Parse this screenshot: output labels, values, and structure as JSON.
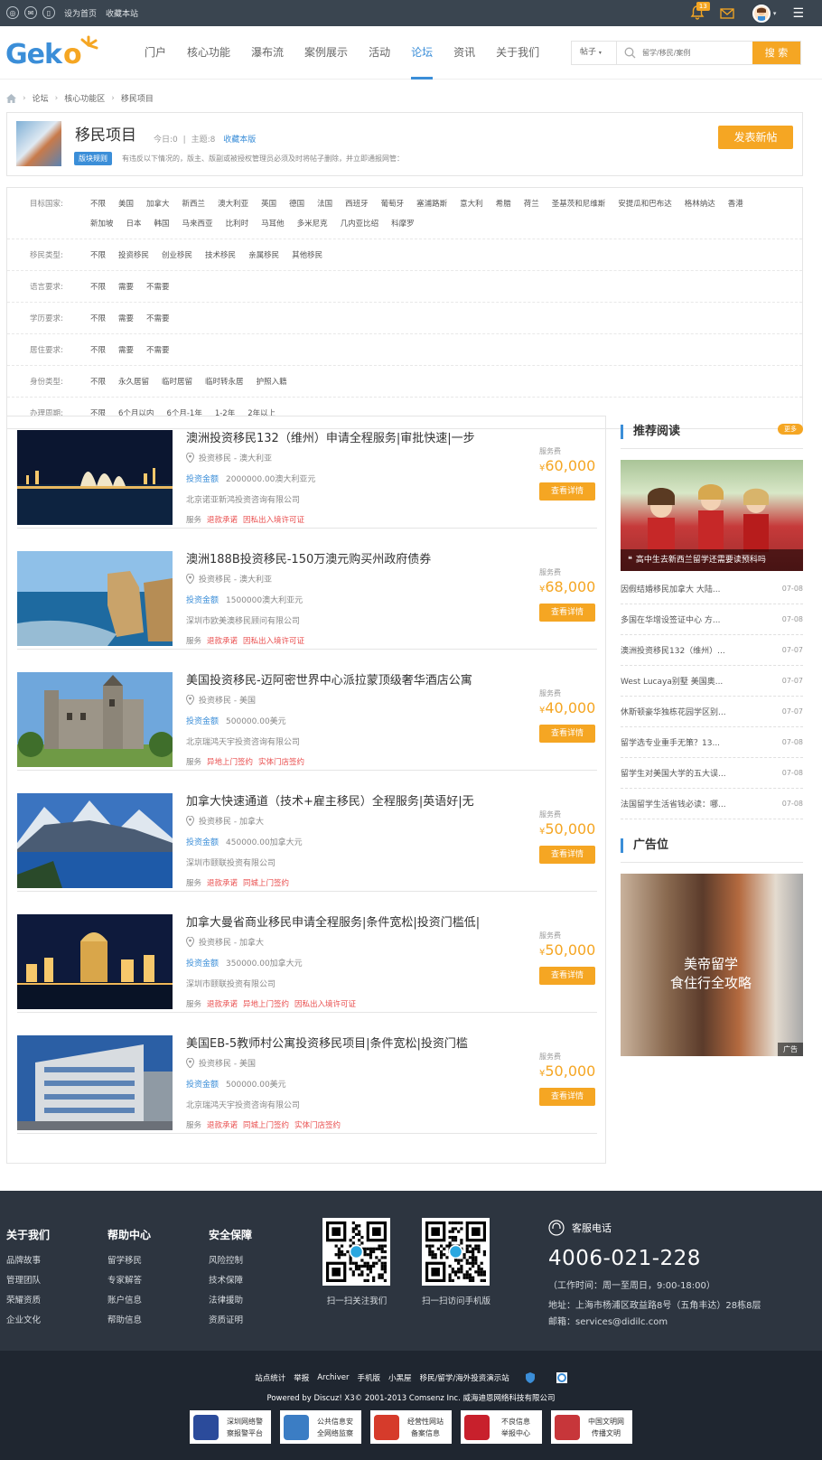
{
  "topbar": {
    "set_home": "设为首页",
    "bookmark": "收藏本站",
    "notice_count": "13"
  },
  "header": {
    "logo": "Geko",
    "nav": [
      "门户",
      "核心功能",
      "瀑布流",
      "案例展示",
      "活动",
      "论坛",
      "资讯",
      "关于我们"
    ],
    "active_nav": "论坛",
    "search_type": "帖子",
    "search_placeholder": "留学/移民/案例",
    "search_button": "搜 索"
  },
  "breadcrumb": [
    "论坛",
    "核心功能区",
    "移民项目"
  ],
  "forum": {
    "name": "移民项目",
    "today": "今日:0",
    "sep": "|",
    "topics": "主题:8",
    "favorite": "收藏本版",
    "rule_label": "版块规则",
    "notice": "有违反以下情况的，版主、版副或被授权管理员必须及时将帖子删除，并立即通报网管：",
    "post_button": "发表新帖"
  },
  "filters": [
    {
      "label": "目标国家:",
      "options": [
        "不限",
        "美国",
        "加拿大",
        "新西兰",
        "澳大利亚",
        "英国",
        "德国",
        "法国",
        "西班牙",
        "葡萄牙",
        "塞浦路斯",
        "意大利",
        "希腊",
        "荷兰",
        "圣基茨和尼维斯",
        "安提瓜和巴布达",
        "格林纳达",
        "香港",
        "新加坡",
        "日本",
        "韩国",
        "马来西亚",
        "比利时",
        "马耳他",
        "多米尼克",
        "几内亚比绍",
        "科摩罗"
      ]
    },
    {
      "label": "移民类型:",
      "options": [
        "不限",
        "投资移民",
        "创业移民",
        "技术移民",
        "亲属移民",
        "其他移民"
      ]
    },
    {
      "label": "语言要求:",
      "options": [
        "不限",
        "需要",
        "不需要"
      ]
    },
    {
      "label": "学历要求:",
      "options": [
        "不限",
        "需要",
        "不需要"
      ]
    },
    {
      "label": "居住要求:",
      "options": [
        "不限",
        "需要",
        "不需要"
      ]
    },
    {
      "label": "身份类型:",
      "options": [
        "不限",
        "永久居留",
        "临时居留",
        "临时转永居",
        "护照入籍"
      ]
    },
    {
      "label": "办理周期:",
      "options": [
        "不限",
        "6个月以内",
        "6个月-1年",
        "1-2年",
        "2年以上"
      ]
    }
  ],
  "listing_labels": {
    "amount": "投资金额",
    "service": "服务",
    "fee": "服务费",
    "currency": "¥",
    "detail": "查看详情"
  },
  "items": [
    {
      "title": "澳洲投资移民132（维州）申请全程服务|审批快速|一步",
      "location": "投资移民 - 澳大利亚",
      "amount": "2000000.00澳大利亚元",
      "company": "北京诺亚新鸿投资咨询有限公司",
      "tags": [
        "退款承诺",
        "因私出入境许可证"
      ],
      "price": "60,000"
    },
    {
      "title": "澳洲188B投资移民-150万澳元购买州政府债券",
      "location": "投资移民 - 澳大利亚",
      "amount": "1500000澳大利亚元",
      "company": "深圳市欧美澳移民顾问有限公司",
      "tags": [
        "退款承诺",
        "因私出入境许可证"
      ],
      "price": "68,000"
    },
    {
      "title": "美国投资移民-迈阿密世界中心派拉蒙顶级奢华酒店公寓",
      "location": "投资移民 - 美国",
      "amount": "500000.00美元",
      "company": "北京瑞鸿天宇投资咨询有限公司",
      "tags": [
        "异地上门签约",
        "实体门店签约"
      ],
      "price": "40,000"
    },
    {
      "title": "加拿大快速通道（技术+雇主移民）全程服务|英语好|无",
      "location": "投资移民 - 加拿大",
      "amount": "450000.00加拿大元",
      "company": "深圳市颐联投资有限公司",
      "tags": [
        "退款承诺",
        "同城上门签约"
      ],
      "price": "50,000"
    },
    {
      "title": "加拿大曼省商业移民申请全程服务|条件宽松|投资门槛低|",
      "location": "投资移民 - 加拿大",
      "amount": "350000.00加拿大元",
      "company": "深圳市颐联投资有限公司",
      "tags": [
        "退款承诺",
        "异地上门签约",
        "因私出入境许可证"
      ],
      "price": "50,000"
    },
    {
      "title": "美国EB-5教师村公寓投资移民项目|条件宽松|投资门槛",
      "location": "投资移民 - 美国",
      "amount": "500000.00美元",
      "company": "北京瑞鸿天宇投资咨询有限公司",
      "tags": [
        "退款承诺",
        "同城上门签约",
        "实体门店签约"
      ],
      "price": "50,000"
    }
  ],
  "sidebar": {
    "rec_title": "推荐阅读",
    "more": "更多",
    "rec_caption": "高中生去新西兰留学还需要读预科吗",
    "articles": [
      {
        "title": "因假结婚移民加拿大 大陆...",
        "date": "07-08"
      },
      {
        "title": "多国在华增设签证中心 方...",
        "date": "07-08"
      },
      {
        "title": "澳洲投资移民132（维州）...",
        "date": "07-07"
      },
      {
        "title": "West Lucaya别墅 美国奥...",
        "date": "07-07"
      },
      {
        "title": "休斯顿豪华独栋花园学区别...",
        "date": "07-07"
      },
      {
        "title": "留学选专业重手无策？13...",
        "date": "07-08"
      },
      {
        "title": "留学生对美国大学的五大误...",
        "date": "07-08"
      },
      {
        "title": "法国留学生活省钱必读：哪...",
        "date": "07-08"
      }
    ],
    "ad_title": "广告位",
    "ad_text": "美帝留学\n食住行全攻略",
    "ad_tag": "广告"
  },
  "footer": {
    "cols": [
      {
        "title": "关于我们",
        "links": [
          "品牌故事",
          "管理团队",
          "荣耀资质",
          "企业文化"
        ]
      },
      {
        "title": "帮助中心",
        "links": [
          "留学移民",
          "专家解答",
          "账户信息",
          "帮助信息"
        ]
      },
      {
        "title": "安全保障",
        "links": [
          "风险控制",
          "技术保障",
          "法律援助",
          "资质证明"
        ]
      }
    ],
    "qr1": "扫一扫关注我们",
    "qr2": "扫一扫访问手机版",
    "hotline_label": "客服电话",
    "hotline": "4006-021-228",
    "hours": "（工作时间：周一至周日，9:00-18:00）",
    "address": "地址：上海市杨浦区政益路8号（五角丰达）28栋8层",
    "email": "邮箱：services@didilc.com"
  },
  "bottom": {
    "links": [
      "站点统计",
      "举报",
      "Archiver",
      "手机版",
      "小黑屋",
      "移民/留学/海外投资演示站"
    ],
    "powered": "Powered by Discuz! X3© 2001-2013 Comsenz Inc.  威海迪恩网络科技有限公司",
    "badges": [
      {
        "l1": "深圳网络警",
        "l2": "察报警平台",
        "color": "#2b4b9b"
      },
      {
        "l1": "公共信息安",
        "l2": "全网络监察",
        "color": "#3b7dc4"
      },
      {
        "l1": "经营性网站",
        "l2": "备案信息",
        "color": "#d63b2b"
      },
      {
        "l1": "不良信息",
        "l2": "举报中心",
        "color": "#c8202c"
      },
      {
        "l1": "中国文明网",
        "l2": "传播文明",
        "color": "#c7363a"
      }
    ]
  }
}
